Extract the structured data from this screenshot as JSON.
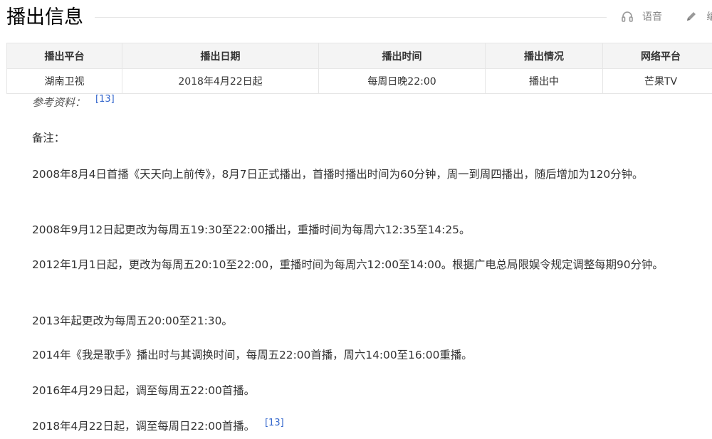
{
  "header": {
    "title": "播出信息",
    "tools": [
      {
        "icon": "headphones-icon",
        "label": "语音"
      },
      {
        "icon": "pencil-icon",
        "label": "编辑"
      }
    ]
  },
  "table": {
    "headers": [
      "播出平台",
      "播出日期",
      "播出时间",
      "播出情况",
      "网络平台"
    ],
    "rows": [
      [
        "湖南卫视",
        "2018年4月22日起",
        "每周日晚22:00",
        "播出中",
        "芒果TV"
      ]
    ]
  },
  "reference": {
    "label": "参考资料：",
    "ref": "[13]"
  },
  "notes": {
    "heading": "备注：",
    "items": [
      {
        "text": "2008年8月4日首播《天天向上前传》，8月7日正式播出，首播时播出时间为60分钟，周一到周四播出，随后增加为120分钟。"
      },
      {
        "text": "2008年9月12日起更改为每周五19:30至22:00播出，重播时间为每周六12:35至14:25。"
      },
      {
        "text": "2012年1月1日起，更改为每周五20:10至22:00，重播时间为每周六12:00至14:00。根据广电总局限娱令规定调整每期90分钟。"
      },
      {
        "text": "2013年起更改为每周五20:00至21:30。"
      },
      {
        "text": "2014年《我是歌手》播出时与其调换时间，每周五22:00首播，周六14:00至16:00重播。"
      },
      {
        "text": "2016年4月29日起，调至每周五22:00首播。"
      },
      {
        "text": "2018年4月22日起，调至每周日22:00首播。",
        "ref": "[13]"
      }
    ]
  }
}
